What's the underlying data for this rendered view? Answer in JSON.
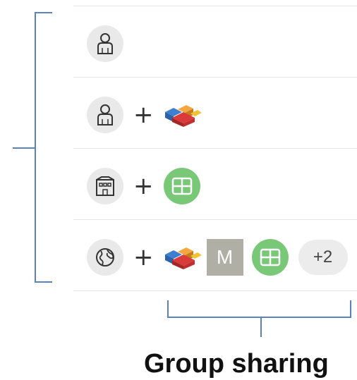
{
  "rows": [
    {
      "scope_icon": "person-icon",
      "shared_with": []
    },
    {
      "scope_icon": "person-icon",
      "plus": "+",
      "shared_with": [
        "bricks-app-icon"
      ]
    },
    {
      "scope_icon": "building-icon",
      "plus": "+",
      "shared_with": [
        "group-grid-icon"
      ]
    },
    {
      "scope_icon": "globe-icon",
      "plus": "+",
      "shared_with": [
        "bricks-app-icon",
        "letter-tile",
        "group-grid-icon",
        "more-count"
      ],
      "letter": "M",
      "more_count": "+2"
    }
  ],
  "caption": "Group sharing",
  "colors": {
    "bracket": "#5b82c0",
    "scope_circle": "#e9e9e9",
    "group_green": "#78c878",
    "letter_tile": "#b0afa6",
    "divider": "#e4e4e4"
  }
}
